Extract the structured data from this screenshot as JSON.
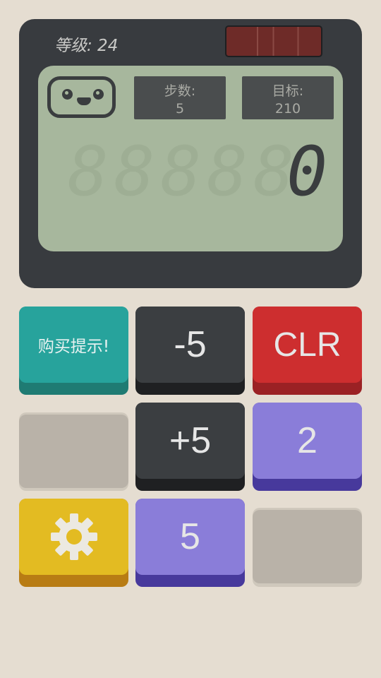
{
  "header": {
    "level_text": "等级: 24"
  },
  "display": {
    "moves_label": "步数:",
    "moves_value": "5",
    "goal_label": "目标:",
    "goal_value": "210",
    "current_value": "0",
    "ghost_digits": "88888"
  },
  "buttons": {
    "hint_label": "购买提示!",
    "minus5_label": "-5",
    "clear_label": "CLR",
    "plus5_label": "+5",
    "two_label": "2",
    "five_label": "5"
  },
  "icons": {
    "settings": "gear-icon",
    "mascot": "calculator-face-icon"
  },
  "colors": {
    "background": "#e5ddd1",
    "device": "#383b3f",
    "screen": "#a7b79d",
    "teal": "#27a39c",
    "red": "#cd2e2f",
    "purple": "#8a7dd9",
    "yellow": "#e3bb22",
    "dark": "#3b3e41"
  }
}
